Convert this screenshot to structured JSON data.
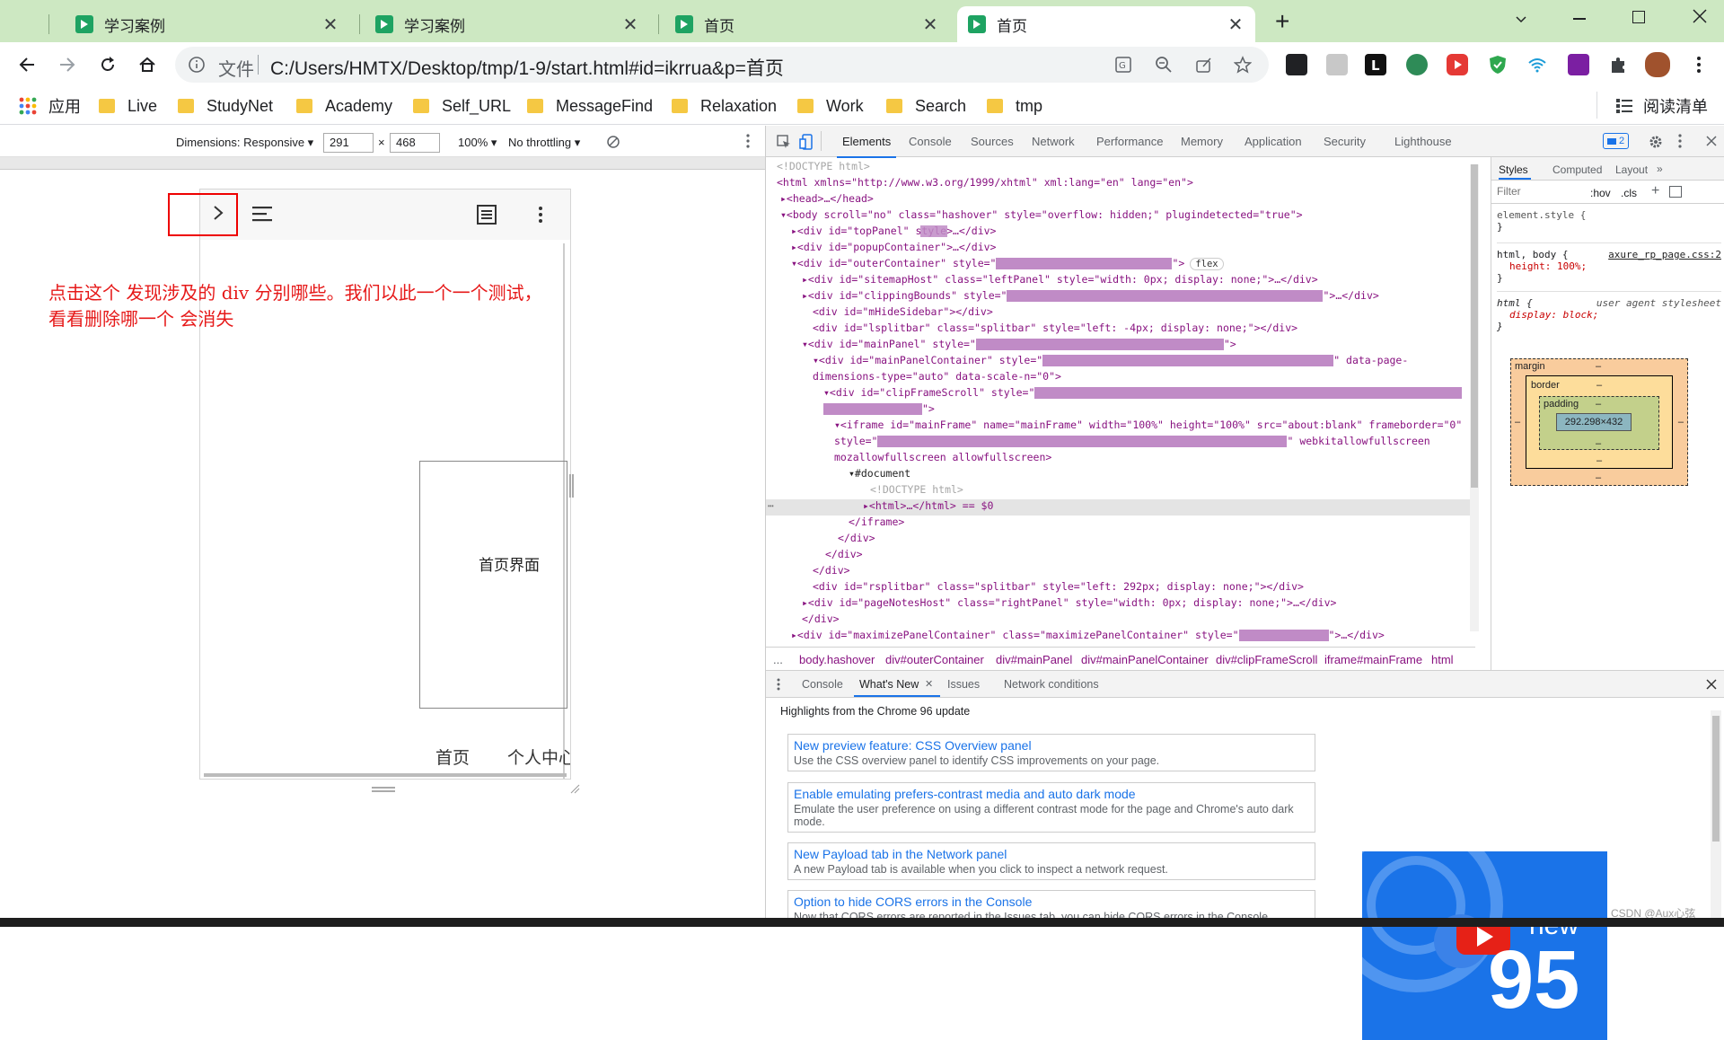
{
  "tabs": [
    {
      "title": "学习案例",
      "active": false
    },
    {
      "title": "学习案例",
      "active": false
    },
    {
      "title": "首页",
      "active": false
    },
    {
      "title": "首页",
      "active": true
    }
  ],
  "new_tab_label": "+",
  "tab_close": "✕",
  "omnibox": {
    "protocol_label": "文件",
    "url": "C:/Users/HMTX/Desktop/tmp/1-9/start.html#id=ikrrua&p=首页"
  },
  "bookmarks": {
    "apps_label": "应用",
    "folders": [
      "Live",
      "StudyNet",
      "Academy",
      "Self_URL",
      "MessageFind",
      "Relaxation",
      "Work",
      "Search",
      "tmp"
    ],
    "reading_list": "阅读清单"
  },
  "device_toolbar": {
    "dimensions_label": "Dimensions: Responsive ▾",
    "width": "291",
    "times": "×",
    "height": "468",
    "zoom": "100% ▾",
    "throttle": "No throttling ▾"
  },
  "annotation": "点击这个 发现涉及的 div 分别哪些。我们以此一个一个测试，看看删除哪一个 会消失",
  "page": {
    "center_label": "首页界面",
    "nav_home": "首页",
    "nav_profile": "个人中心"
  },
  "devtools": {
    "tabs": [
      "Elements",
      "Console",
      "Sources",
      "Network",
      "Performance",
      "Memory",
      "Application",
      "Security",
      "Lighthouse"
    ],
    "issues_badge": "2",
    "styles_tabs": [
      "Styles",
      "Computed",
      "Layout",
      "»"
    ],
    "filter_placeholder": "Filter",
    "hov_label": ":hov",
    "cls_label": ".cls",
    "styles_rules": [
      {
        "selector": "element.style {",
        "props": [],
        "source": ""
      },
      {
        "selector": "html, body {",
        "props": [
          "height: 100%;"
        ],
        "source": "axure_rp_page.css:2"
      },
      {
        "selector": "html {",
        "props": [
          "display: block;"
        ],
        "source": "user agent stylesheet"
      }
    ],
    "close_brace": "}",
    "box_model": {
      "margin": "margin",
      "border": "border",
      "padding": "padding",
      "content": "292.298×432",
      "dash": "–"
    },
    "breadcrumbs": [
      "body.hashover",
      "div#outerContainer",
      "div#mainPanel",
      "div#mainPanelContainer",
      "div#clipFrameScroll",
      "iframe#mainFrame",
      "html"
    ],
    "dom_lines": [
      "<!DOCTYPE html>",
      "<html xmlns=\"http://www.w3.org/1999/xhtml\" xml:lang=\"en\" lang=\"en\">",
      "▸<head>…</head>",
      "▾<body scroll=\"no\" class=\"hashover\" style=\"overflow: hidden;\" plugindetected=\"true\">",
      "▸<div id=\"topPanel\" style>…</div>",
      "▸<div id=\"popupContainer\">…</div>",
      "▾<div id=\"outerContainer\" style=\"",
      "▸<div id=\"sitemapHost\" class=\"leftPanel\" style=\"width: 0px; display: none;\">…</div>",
      "▸<div id=\"clippingBounds\" style=\"",
      "<div id=\"mHideSidebar\"></div>",
      "<div id=\"lsplitbar\" class=\"splitbar\" style=\"left: -4px; display: none;\"></div>",
      "▾<div id=\"mainPanel\" style=\"",
      "▾<div id=\"mainPanelContainer\" style=\"",
      "dimensions-type=\"auto\" data-scale-n=\"0\">",
      "▾<div id=\"clipFrameScroll\" style=\"",
      "\">",
      "▾<iframe id=\"mainFrame\" name=\"mainFrame\" width=\"100%\" height=\"100%\" src=\"about:blank\" frameborder=\"0\"",
      "style=\"",
      "mozallowfullscreen allowfullscreen>",
      "▾#document",
      "<!DOCTYPE html>",
      "▸<html>…</html> == $0",
      "</iframe>",
      "</div>",
      "</div>",
      "</div>",
      "<div id=\"rsplitbar\" class=\"splitbar\" style=\"left: 292px; display: none;\"></div>",
      "▸<div id=\"pageNotesHost\" class=\"rightPanel\" style=\"width: 0px; display: none;\">…</div>",
      "</div>",
      "▸<div id=\"maximizePanelContainer\" class=\"maximizePanelContainer\" style=\""
    ],
    "dom_suffixes": {
      "outer": "\">",
      "flex": "flex",
      "clipping": "\">…</div>",
      "mainpanel": "\">",
      "mpc": "\" data-page-",
      "iframe_end": "\" webkitallowfullscreen",
      "max": "\">…</div>",
      "ellipsis": "...",
      "dots": "⋯"
    },
    "drawer": {
      "tabs": [
        "Console",
        "What's New",
        "Issues",
        "Network conditions"
      ],
      "tab_close": "✕",
      "highlights": "Highlights from the Chrome 96 update",
      "cards": [
        {
          "title": "New preview feature: CSS Overview panel",
          "desc": "Use the CSS overview panel to identify CSS improvements on your page."
        },
        {
          "title": "Enable emulating prefers-contrast media and auto dark mode",
          "desc": "Emulate the user preference on using a different contrast mode for the page and Chrome's auto dark mode."
        },
        {
          "title": "New Payload tab in the Network panel",
          "desc": "A new Payload tab is available when you click to inspect a network request."
        },
        {
          "title": "Option to hide CORS errors in the Console",
          "desc": "Now that CORS errors are reported in the Issues tab, you can hide CORS errors in the Console."
        }
      ],
      "promo_new": "new",
      "promo_num": "95"
    }
  },
  "watermark": "CSDN @Aux心弦",
  "colors": {
    "tabbar": "#cde8c2",
    "accent": "#1a73e8",
    "annotation": "#e61919",
    "highlight": "#c08bc6"
  }
}
